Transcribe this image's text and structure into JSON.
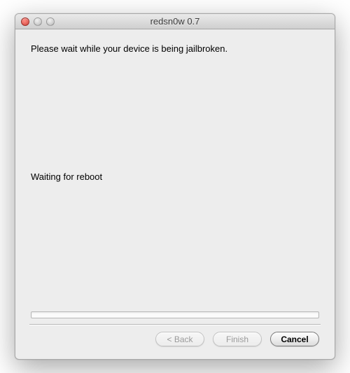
{
  "window": {
    "title": "redsn0w 0.7"
  },
  "content": {
    "instruction": "Please wait while your device is being jailbroken.",
    "status": "Waiting for reboot"
  },
  "buttons": {
    "back_label": "< Back",
    "finish_label": "Finish",
    "cancel_label": "Cancel"
  }
}
